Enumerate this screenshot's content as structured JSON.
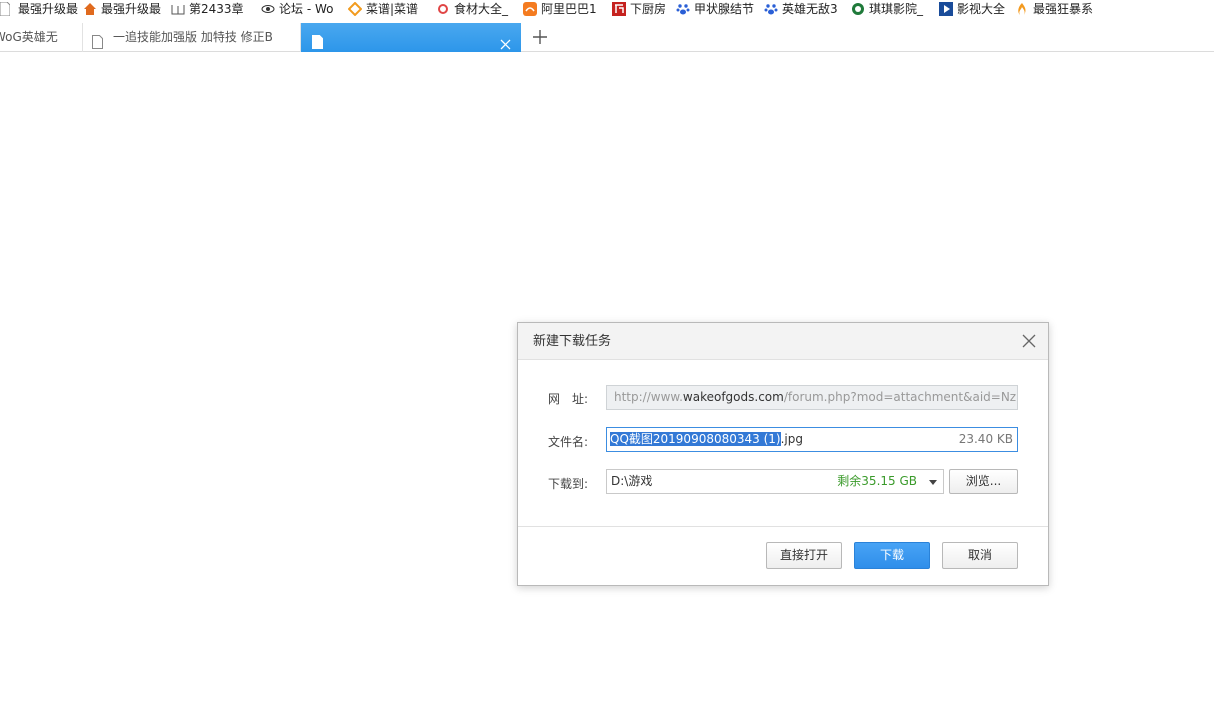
{
  "bookmarks": [
    {
      "label": "最强升级最",
      "icon": "page-icon",
      "color": "#888888"
    },
    {
      "label": "最强升级最",
      "icon": "house-icon",
      "color": "#e06a1e"
    },
    {
      "label": "第2433章",
      "icon": "book-icon",
      "color": "#555555"
    },
    {
      "label": "论坛 - Wo",
      "icon": "eye-icon",
      "color": "#333333"
    },
    {
      "label": "菜谱|菜谱",
      "icon": "diamond-icon",
      "color": "#f29b1e"
    },
    {
      "label": "食材大全_",
      "icon": "ring-icon",
      "color": "#e04545"
    },
    {
      "label": "阿里巴巴1",
      "icon": "alibaba-icon",
      "color": "#f47b20"
    },
    {
      "label": "下厨房",
      "icon": "xiachufang-icon",
      "color": "#c5221f"
    },
    {
      "label": "甲状腺结节",
      "icon": "paw-icon",
      "color": "#2a5fd6"
    },
    {
      "label": "英雄无敌3",
      "icon": "paw-icon",
      "color": "#2a5fd6"
    },
    {
      "label": "琪琪影院_",
      "icon": "film-ring-icon",
      "color": "#1f7a3a"
    },
    {
      "label": "影视大全",
      "icon": "play-icon",
      "color": "#1a4c9a"
    },
    {
      "label": "最强狂暴系",
      "icon": "flame-icon",
      "color": "#f39a1f"
    }
  ],
  "tabs": [
    {
      "label": "WoG英雄无"
    },
    {
      "label": "一追技能加强版 加特技 修正B"
    },
    {
      "label": ""
    }
  ],
  "dialog": {
    "title": "新建下载任务",
    "url_label": "网　址:",
    "url_prefix": "http://www.",
    "url_host": "wakeofgods.com",
    "url_rest": "/forum.php?mod=attachment&aid=NzE",
    "filename_label": "文件名:",
    "filename_selected": "QQ截图20190908080343 (1)",
    "filename_ext": ".jpg",
    "file_size": "23.40 KB",
    "saveto_label": "下载到:",
    "save_dir": "D:\\游戏",
    "free_space": "剩余35.15 GB",
    "browse_label": "浏览...",
    "open_label": "直接打开",
    "download_label": "下载",
    "cancel_label": "取消"
  }
}
